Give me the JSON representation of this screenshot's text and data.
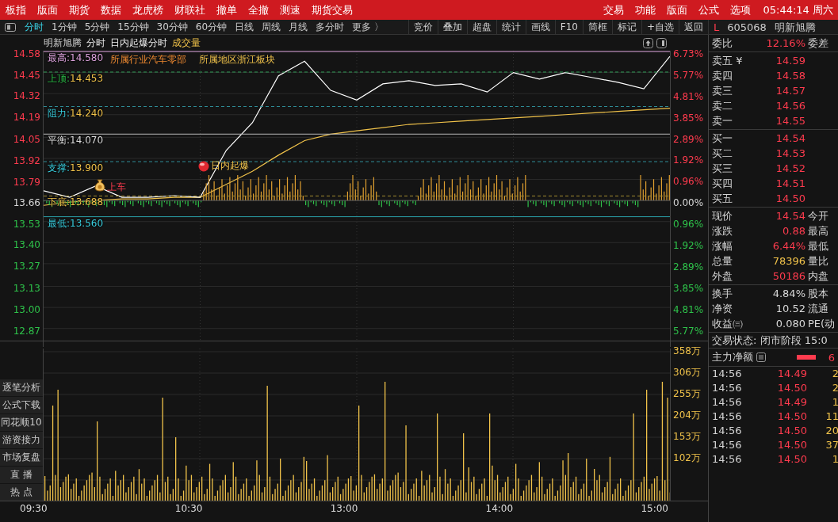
{
  "menu_bar": {
    "items": [
      "板指",
      "版面",
      "期货",
      "数据",
      "龙虎榜",
      "财联社",
      "撤单",
      "全撤",
      "测速",
      "期货交易"
    ],
    "right_items": [
      "交易",
      "功能",
      "版面",
      "公式",
      "选项"
    ],
    "clock": "05:44:14 周六"
  },
  "toolbar": {
    "periods": [
      {
        "label": "分时",
        "selected": true
      },
      {
        "label": "1分钟",
        "selected": false
      },
      {
        "label": "5分钟",
        "selected": false
      },
      {
        "label": "15分钟",
        "selected": false
      },
      {
        "label": "30分钟",
        "selected": false
      },
      {
        "label": "60分钟",
        "selected": false
      },
      {
        "label": "日线",
        "selected": false
      },
      {
        "label": "周线",
        "selected": false
      },
      {
        "label": "月线",
        "selected": false
      },
      {
        "label": "多分时",
        "selected": false
      },
      {
        "label": "更多 〉",
        "selected": false
      }
    ],
    "tools": [
      "竞价",
      "叠加",
      "超盘",
      "统计",
      "画线",
      "F10",
      "简框",
      "标记",
      "+自选",
      "返回"
    ]
  },
  "chart_header": {
    "name": "明新旭腾",
    "items": [
      "分时",
      "日内起爆分时"
    ],
    "indicator": "成交量"
  },
  "price_axis": {
    "right": [
      {
        "label": "6.73%",
        "kind": "up"
      },
      {
        "label": "5.77%",
        "kind": "up"
      },
      {
        "label": "4.81%",
        "kind": "up"
      },
      {
        "label": "3.85%",
        "kind": "up"
      },
      {
        "label": "2.89%",
        "kind": "up"
      },
      {
        "label": "1.92%",
        "kind": "up"
      },
      {
        "label": "0.96%",
        "kind": "up"
      },
      {
        "label": "0.00%",
        "kind": "flat"
      },
      {
        "label": "0.96%",
        "kind": "down"
      },
      {
        "label": "1.92%",
        "kind": "down"
      },
      {
        "label": "2.89%",
        "kind": "down"
      },
      {
        "label": "3.85%",
        "kind": "down"
      },
      {
        "label": "4.81%",
        "kind": "down"
      },
      {
        "label": "5.77%",
        "kind": "down"
      }
    ]
  },
  "levels": [
    {
      "label": "最高:",
      "value": "14.580",
      "kind": "high"
    },
    {
      "label": "上顶:",
      "value": "14.453",
      "kind": "top"
    },
    {
      "label": "阻力:",
      "value": "14.240",
      "kind": "resistance"
    },
    {
      "label": "平衡:",
      "value": "14.070",
      "kind": "balance"
    },
    {
      "label": "支撑:",
      "value": "13.900",
      "kind": "support"
    },
    {
      "label": "下底:",
      "value": "13.688",
      "kind": "bottom"
    },
    {
      "label": "最低:",
      "value": "13.560",
      "kind": "low"
    }
  ],
  "tags": [
    "所属行业汽车零部",
    "所属地区浙江板块"
  ],
  "signals": [
    {
      "label": "上车",
      "kind": "buy"
    },
    {
      "label": "日内起爆",
      "kind": "burst"
    }
  ],
  "volume_axis": [
    "358万",
    "306万",
    "255万",
    "204万",
    "153万",
    "102万"
  ],
  "time_axis": [
    "09:30",
    "10:30",
    "13:00",
    "14:00",
    "15:00"
  ],
  "chart_data": {
    "type": "line",
    "ylim": [
      12.87,
      14.58
    ],
    "yticks": [
      {
        "value": 14.58,
        "label": "14.58"
      },
      {
        "value": 14.45,
        "label": "14.45"
      },
      {
        "value": 14.32,
        "label": "14.32"
      },
      {
        "value": 14.19,
        "label": "14.19"
      },
      {
        "value": 14.05,
        "label": "14.05"
      },
      {
        "value": 13.92,
        "label": "13.92"
      },
      {
        "value": 13.79,
        "label": "13.79"
      },
      {
        "value": 13.66,
        "label": "13.66"
      },
      {
        "value": 13.53,
        "label": "13.53"
      },
      {
        "value": 13.4,
        "label": "13.40"
      },
      {
        "value": 13.27,
        "label": "13.27"
      },
      {
        "value": 13.13,
        "label": "13.13"
      },
      {
        "value": 13.0,
        "label": "13.00"
      },
      {
        "value": 12.87,
        "label": "12.87"
      }
    ],
    "grid": true,
    "series": [
      {
        "color": "#ffffff",
        "values": [
          13.72,
          13.68,
          13.75,
          13.68,
          13.68,
          13.69,
          13.68,
          13.97,
          14.14,
          14.43,
          14.52,
          14.34,
          14.28,
          14.38,
          14.4,
          14.37,
          14.38,
          14.33,
          14.45,
          14.41,
          14.45,
          14.42,
          14.39,
          14.35,
          14.55
        ]
      },
      {
        "color": "#f0c24a",
        "values": [
          13.63,
          13.65,
          13.66,
          13.67,
          13.67,
          13.68,
          13.68,
          13.76,
          13.84,
          13.94,
          14.03,
          14.07,
          14.09,
          14.11,
          14.13,
          14.14,
          14.15,
          14.16,
          14.17,
          14.18,
          14.19,
          14.2,
          14.21,
          14.22,
          14.23
        ]
      }
    ]
  },
  "side_buttons": [
    "逐笔分析",
    "公式下载",
    "同花顺10",
    "游资接力",
    "市场复盘",
    "直 播",
    "热 点"
  ],
  "quote": {
    "flag": "L",
    "code": "605068",
    "name": "明新旭腾",
    "ratio": {
      "label": "委比",
      "value": "12.16%",
      "label2": "委差"
    },
    "asks": [
      {
        "label": "卖五 ¥",
        "price": "14.59"
      },
      {
        "label": "卖四",
        "price": "14.58"
      },
      {
        "label": "卖三",
        "price": "14.57"
      },
      {
        "label": "卖二",
        "price": "14.56"
      },
      {
        "label": "卖一",
        "price": "14.55"
      }
    ],
    "bids": [
      {
        "label": "买一",
        "price": "14.54"
      },
      {
        "label": "买二",
        "price": "14.53"
      },
      {
        "label": "买三",
        "price": "14.52"
      },
      {
        "label": "买四",
        "price": "14.51"
      },
      {
        "label": "买五",
        "price": "14.50"
      }
    ],
    "stats": [
      {
        "label": "现价",
        "value": "14.54",
        "label2": "今开",
        "color": "#ff3b4e"
      },
      {
        "label": "涨跌",
        "value": "0.88",
        "label2": "最高",
        "color": "#ff3b4e"
      },
      {
        "label": "涨幅",
        "value": "6.44%",
        "label2": "最低",
        "color": "#ff3b4e"
      },
      {
        "label": "总量",
        "value": "78396",
        "label2": "量比",
        "color": "#f0c24a"
      },
      {
        "label": "外盘",
        "value": "50186",
        "label2": "内盘",
        "color": "#ff3b4e"
      }
    ],
    "stats2": [
      {
        "label": "换手",
        "value": "4.84%",
        "label2": "股本",
        "color": "#d8d8d8"
      },
      {
        "label": "净资",
        "value": "10.52",
        "label2": "流通",
        "color": "#d8d8d8"
      },
      {
        "label": "收益㈢",
        "value": "0.080",
        "label2": "PE(动",
        "color": "#d8d8d8"
      }
    ],
    "status": "交易状态: 闭市阶段 15:0",
    "net": {
      "label": "主力净额",
      "value": "6"
    },
    "ticks": [
      {
        "time": "14:56",
        "price": "14.49",
        "volume": "2"
      },
      {
        "time": "14:56",
        "price": "14.50",
        "volume": "2"
      },
      {
        "time": "14:56",
        "price": "14.49",
        "volume": "1"
      },
      {
        "time": "14:56",
        "price": "14.50",
        "volume": "11"
      },
      {
        "time": "14:56",
        "price": "14.50",
        "volume": "20"
      },
      {
        "time": "14:56",
        "price": "14.50",
        "volume": "37"
      },
      {
        "time": "14:56",
        "price": "14.50",
        "volume": "1"
      }
    ]
  }
}
